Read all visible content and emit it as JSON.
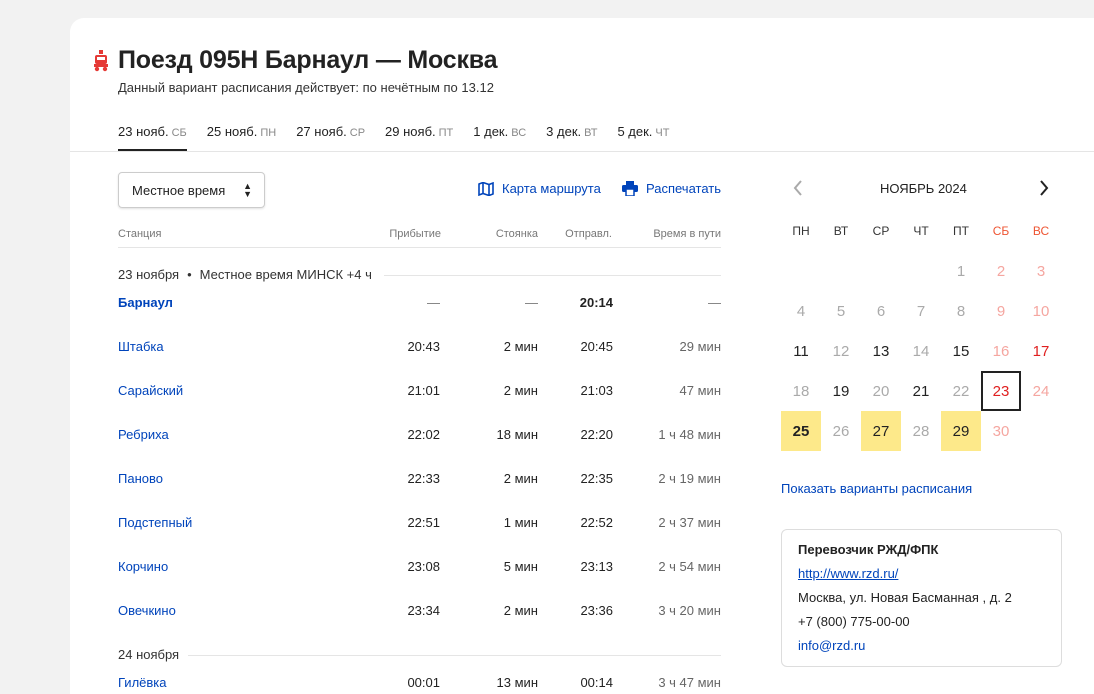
{
  "header": {
    "title": "Поезд 095Н Барнаул — Москва",
    "subtitle": "Данный вариант расписания действует: по нечётным по 13.12"
  },
  "tabs": [
    {
      "label": "23 нояб.",
      "dow": "СБ",
      "active": true
    },
    {
      "label": "25 нояб.",
      "dow": "ПН"
    },
    {
      "label": "27 нояб.",
      "dow": "СР"
    },
    {
      "label": "29 нояб.",
      "dow": "ПТ"
    },
    {
      "label": "1 дек.",
      "dow": "ВС"
    },
    {
      "label": "3 дек.",
      "dow": "ВТ"
    },
    {
      "label": "5 дек.",
      "dow": "ЧТ"
    }
  ],
  "controls": {
    "timezone_select": "Местное время",
    "map_link": "Карта маршрута",
    "print_link": "Распечатать"
  },
  "table": {
    "headers": {
      "station": "Станция",
      "arrival": "Прибытие",
      "stop": "Стоянка",
      "departure": "Отправл.",
      "travel": "Время в пути"
    },
    "date1": {
      "date": "23 ноября",
      "note": "Местное время МИНСК +4 ч"
    },
    "date2": {
      "date": "24 ноября"
    },
    "rows": [
      {
        "station": "Барнаул",
        "arrival": "—",
        "stop": "—",
        "departure": "20:14",
        "travel": "—"
      },
      {
        "station": "Штабка",
        "arrival": "20:43",
        "stop": "2 мин",
        "departure": "20:45",
        "travel": "29 мин"
      },
      {
        "station": "Сарайский",
        "arrival": "21:01",
        "stop": "2 мин",
        "departure": "21:03",
        "travel": "47 мин"
      },
      {
        "station": "Ребриха",
        "arrival": "22:02",
        "stop": "18 мин",
        "departure": "22:20",
        "travel": "1 ч 48 мин"
      },
      {
        "station": "Паново",
        "arrival": "22:33",
        "stop": "2 мин",
        "departure": "22:35",
        "travel": "2 ч 19 мин"
      },
      {
        "station": "Подстепный",
        "arrival": "22:51",
        "stop": "1 мин",
        "departure": "22:52",
        "travel": "2 ч 37 мин"
      },
      {
        "station": "Корчино",
        "arrival": "23:08",
        "stop": "5 мин",
        "departure": "23:13",
        "travel": "2 ч 54 мин"
      },
      {
        "station": "Овечкино",
        "arrival": "23:34",
        "stop": "2 мин",
        "departure": "23:36",
        "travel": "3 ч 20 мин"
      },
      {
        "station": "Гилёвка",
        "arrival": "00:01",
        "stop": "13 мин",
        "departure": "00:14",
        "travel": "3 ч 47 мин"
      }
    ]
  },
  "calendar": {
    "month": "НОЯБРЬ 2024",
    "weekdays": [
      "ПН",
      "ВТ",
      "СР",
      "ЧТ",
      "ПТ",
      "СБ",
      "ВС"
    ],
    "days": [
      "1",
      "2",
      "3",
      "4",
      "5",
      "6",
      "7",
      "8",
      "9",
      "10",
      "11",
      "12",
      "13",
      "14",
      "15",
      "16",
      "17",
      "18",
      "19",
      "20",
      "21",
      "22",
      "23",
      "24",
      "25",
      "26",
      "27",
      "28",
      "29",
      "30"
    ],
    "show_variants": "Показать варианты расписания"
  },
  "carrier": {
    "title": "Перевозчик РЖД/ФПК",
    "url": "http://www.rzd.ru/",
    "address": "Москва, ул. Новая Басманная , д. 2",
    "phone": "+7 (800) 775-00-00",
    "email": "info@rzd.ru"
  },
  "colors": {
    "link": "#0044bb",
    "weekend": "#e02020",
    "highlight": "#fde98a",
    "train_icon": "#e53935"
  }
}
